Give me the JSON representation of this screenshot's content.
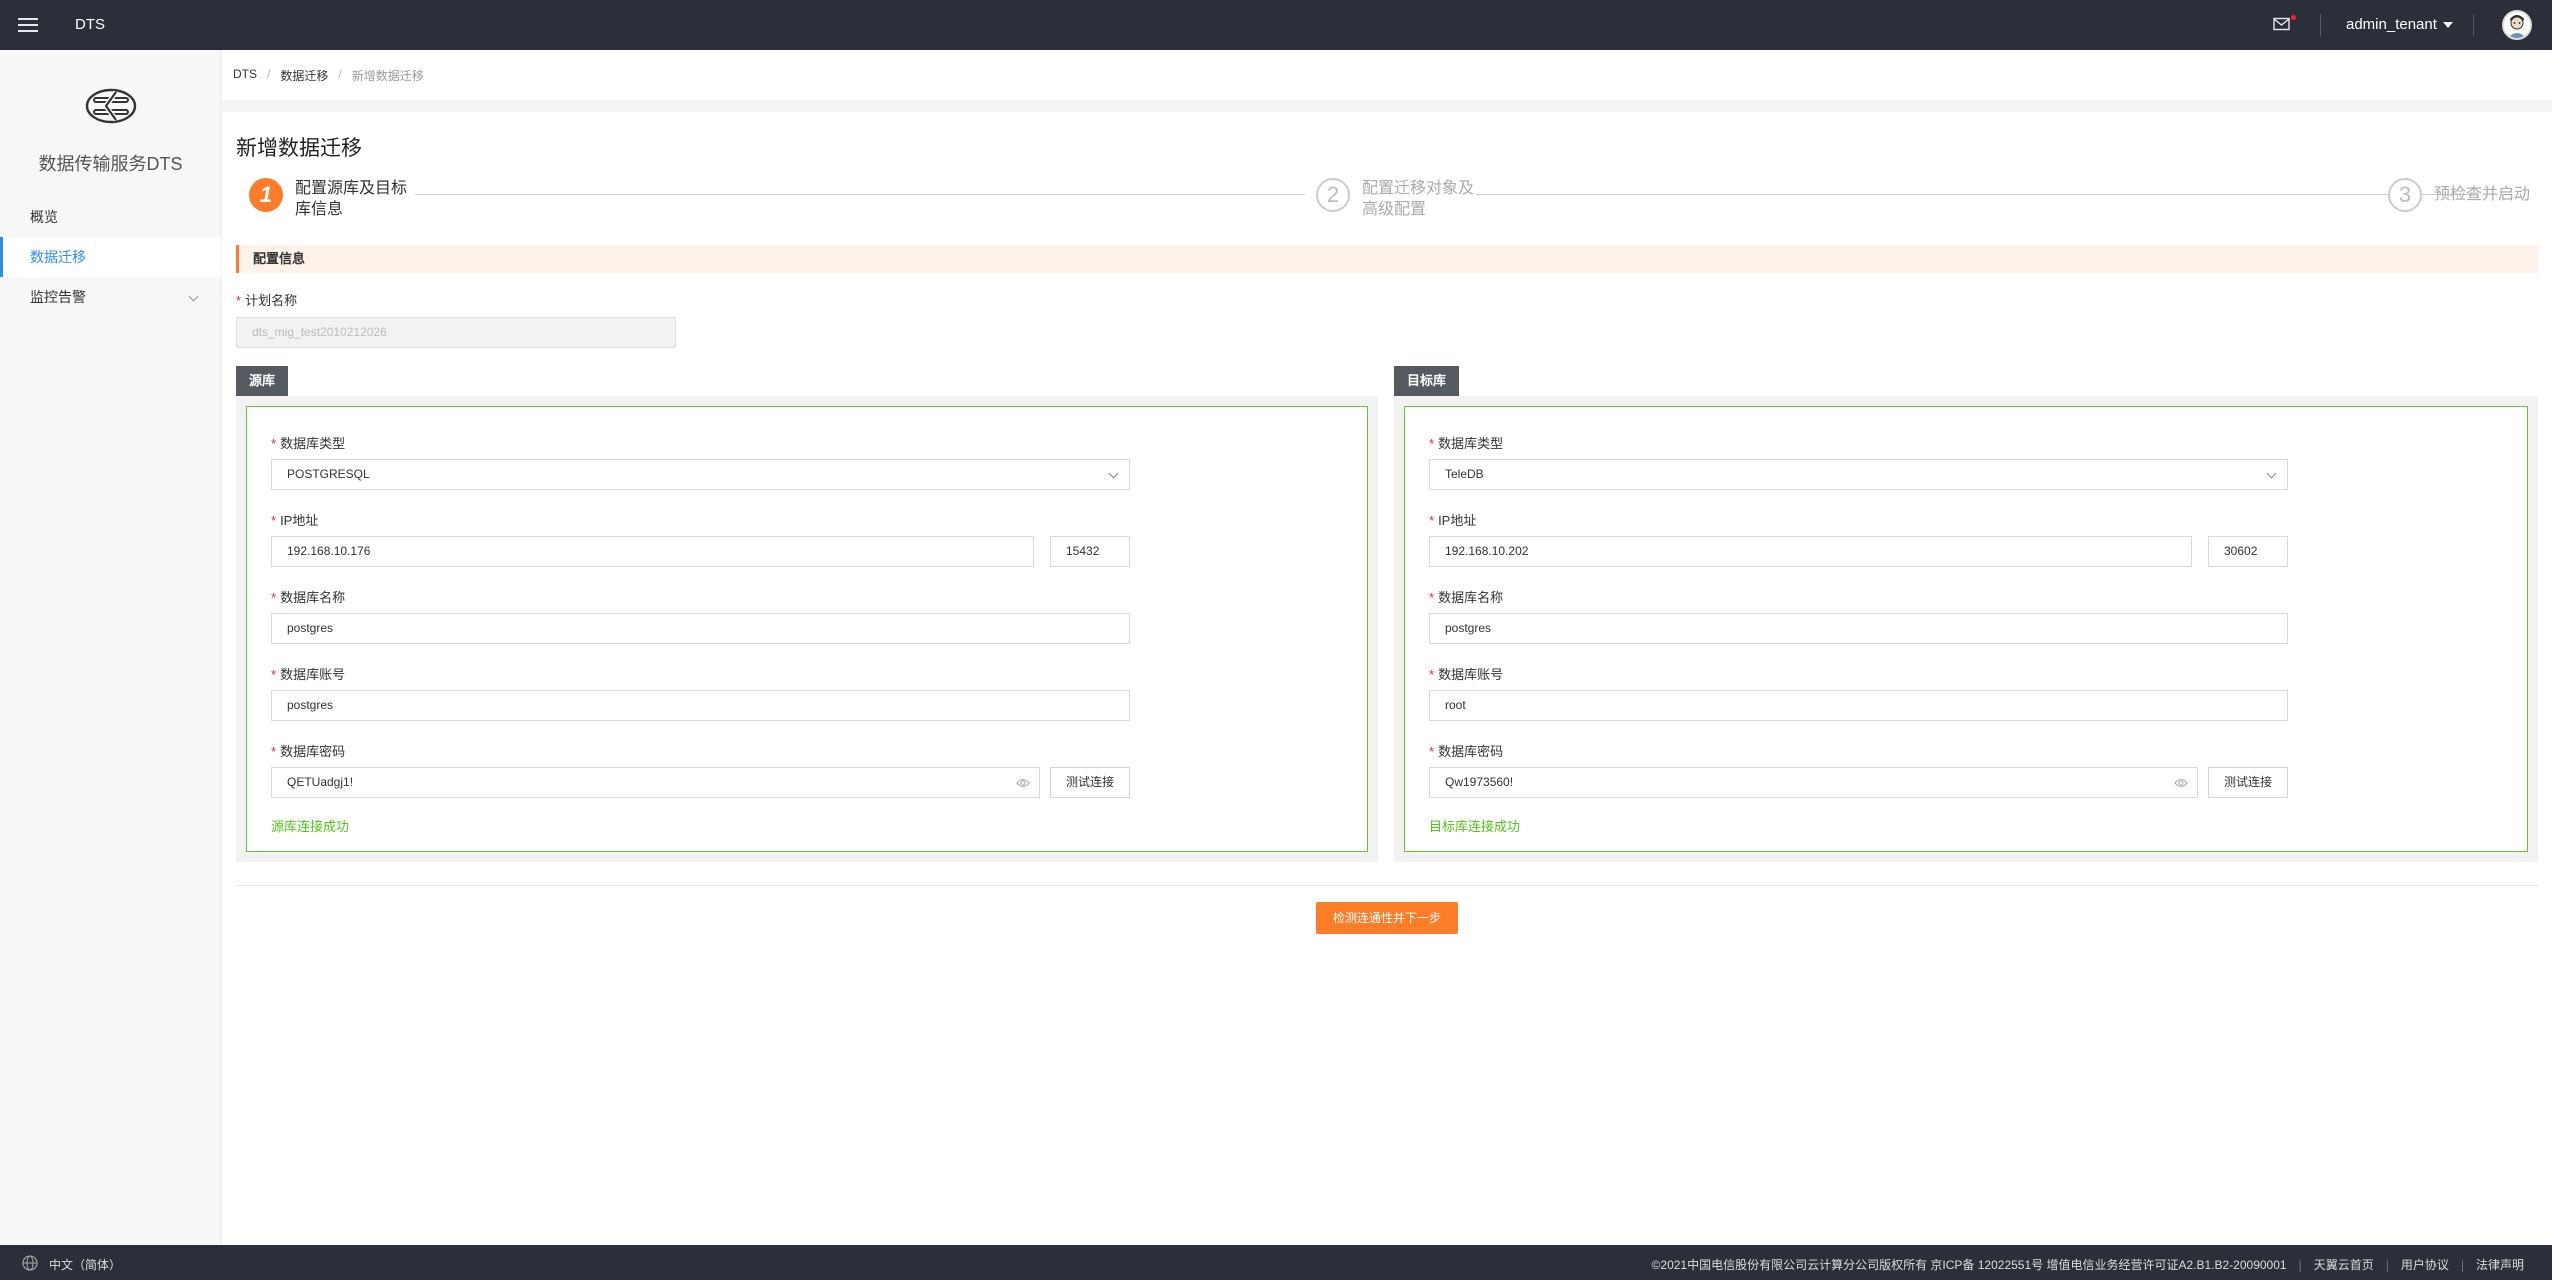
{
  "header": {
    "app_title": "DTS",
    "user_name": "admin_tenant"
  },
  "sidebar": {
    "service_name": "数据传输服务DTS",
    "items": [
      {
        "label": "概览"
      },
      {
        "label": "数据迁移"
      },
      {
        "label": "监控告警"
      }
    ]
  },
  "breadcrumb": {
    "items": [
      "DTS",
      "数据迁移",
      "新增数据迁移"
    ],
    "sep": "/"
  },
  "page": {
    "title": "新增数据迁移",
    "steps": [
      {
        "num": "1",
        "label": "配置源库及目标库信息"
      },
      {
        "num": "2",
        "label": "配置迁移对象及高级配置"
      },
      {
        "num": "3",
        "label": "预检查并启动"
      }
    ],
    "section_title": "配置信息",
    "plan_name_label": "计划名称",
    "plan_name_value": "dts_mig_test2010212026",
    "required_mark": "*"
  },
  "source": {
    "tag": "源库",
    "db_type_label": "数据库类型",
    "db_type_value": "POSTGRESQL",
    "ip_label": "IP地址",
    "ip_value": "192.168.10.176",
    "port_value": "15432",
    "db_name_label": "数据库名称",
    "db_name_value": "postgres",
    "account_label": "数据库账号",
    "account_value": "postgres",
    "password_label": "数据库密码",
    "password_value": "QETUadgj1!",
    "test_button": "测试连接",
    "status": "源库连接成功"
  },
  "target": {
    "tag": "目标库",
    "db_type_label": "数据库类型",
    "db_type_value": "TeleDB",
    "ip_label": "IP地址",
    "ip_value": "192.168.10.202",
    "port_value": "30602",
    "db_name_label": "数据库名称",
    "db_name_value": "postgres",
    "account_label": "数据库账号",
    "account_value": "root",
    "password_label": "数据库密码",
    "password_value": "Qw1973560!",
    "test_button": "测试连接",
    "status": "目标库连接成功"
  },
  "actions": {
    "next_button": "检测连通性并下一步"
  },
  "footer": {
    "language": "中文（简体）",
    "copyright": "©2021中国电信股份有限公司云计算分公司版权所有 京ICP备 12022551号 增值电信业务经营许可证A2.B1.B2-20090001",
    "links": [
      "天翼云首页",
      "用户协议",
      "法律声明"
    ],
    "sep": "|"
  },
  "colors": {
    "accent": "#fb7d27",
    "link": "#2e8df0",
    "success": "#52c41a",
    "topbar": "#2b2f3a"
  }
}
